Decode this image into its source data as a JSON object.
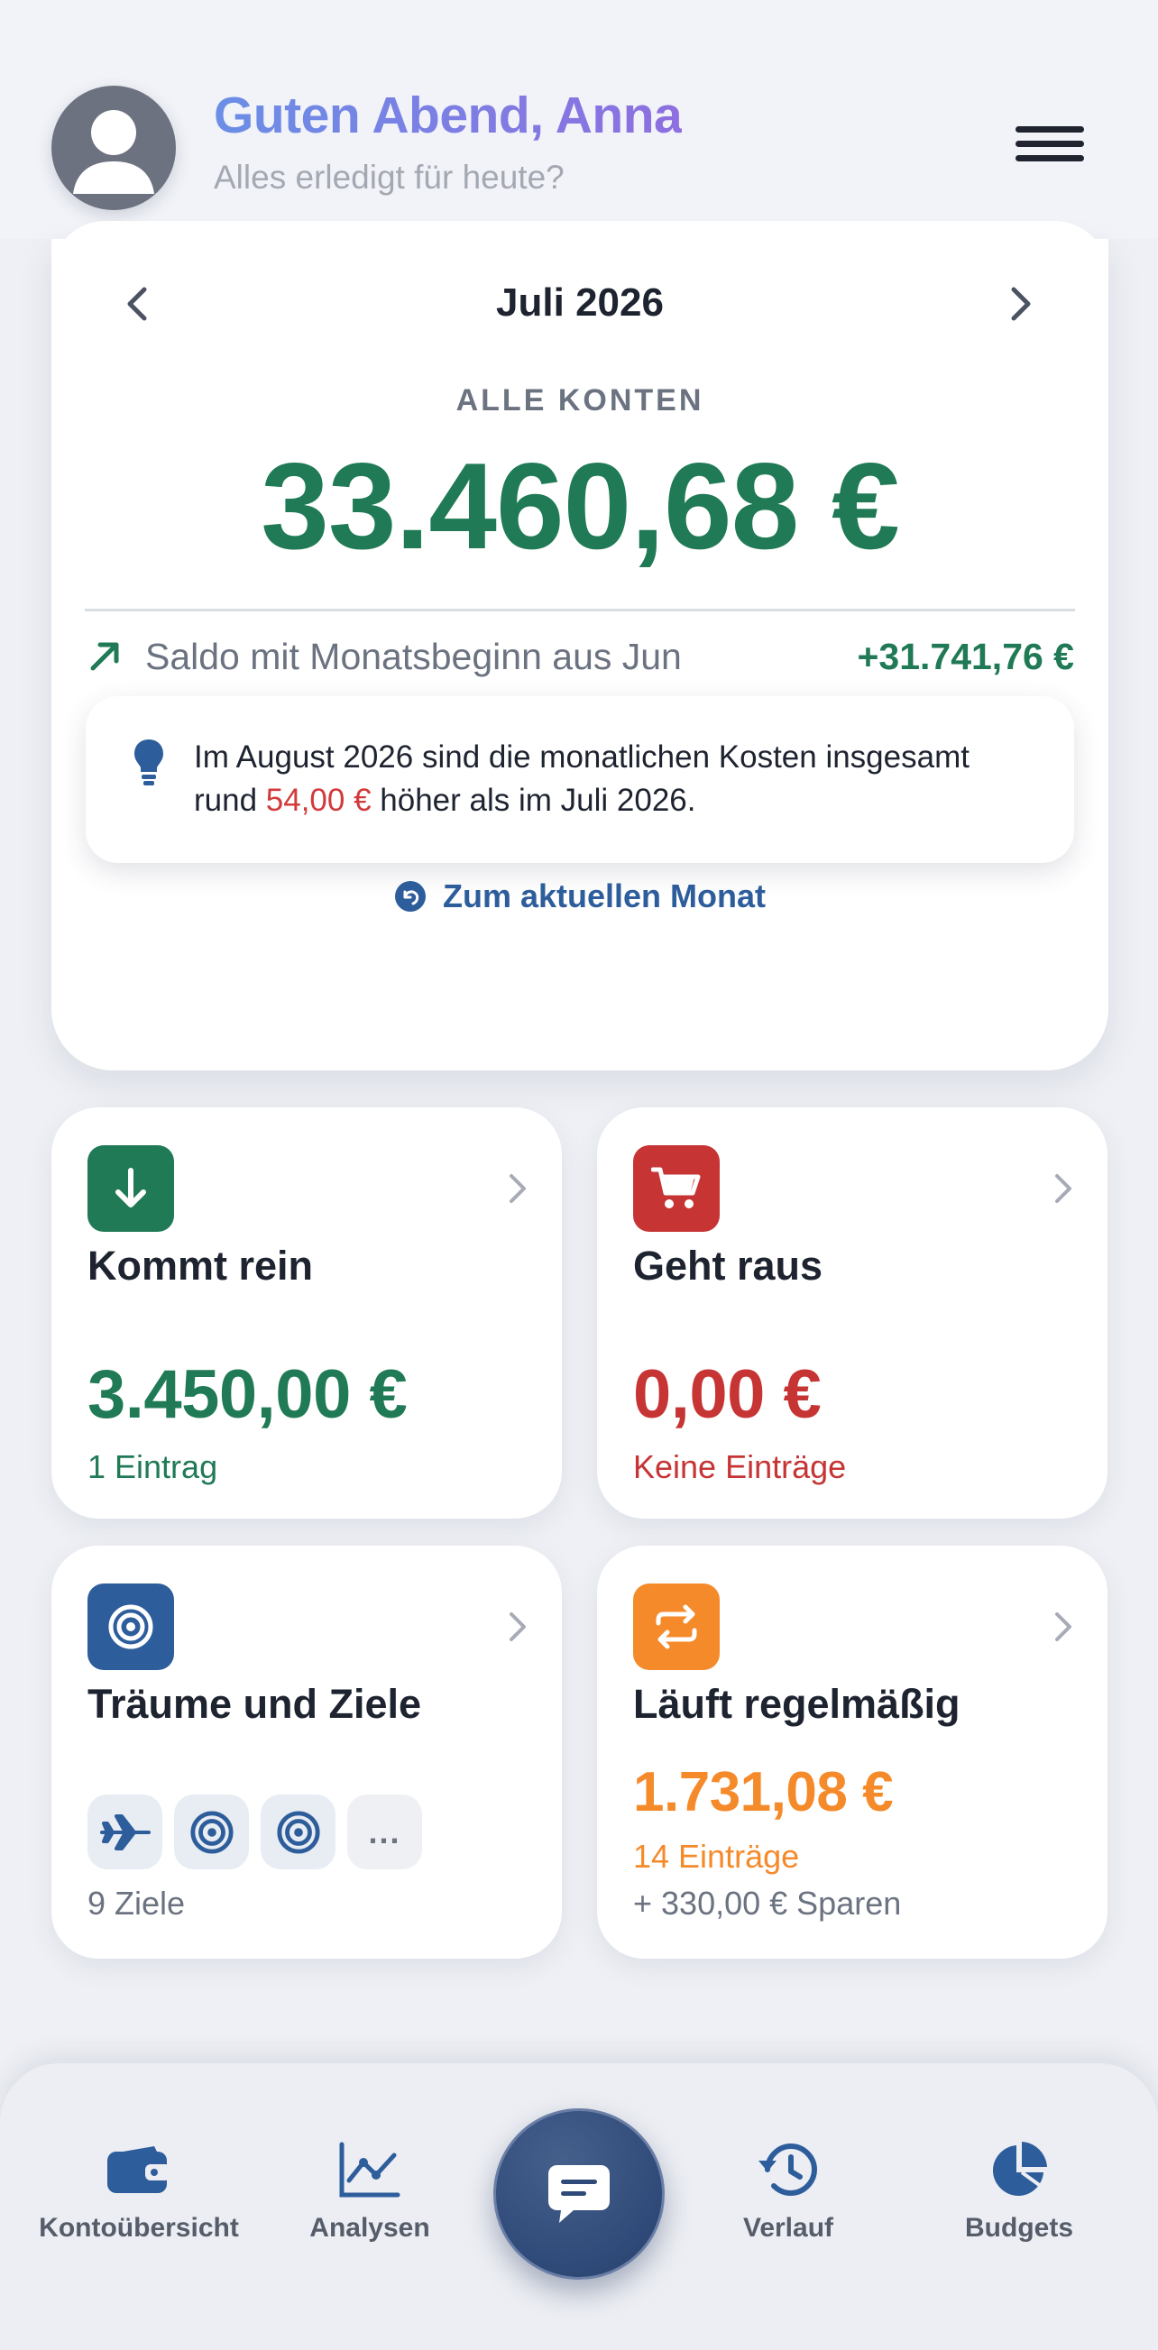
{
  "header": {
    "greeting": "Guten Abend, Anna",
    "subtitle": "Alles erledigt für heute?"
  },
  "overview": {
    "month": "Juli 2026",
    "accounts_label": "ALLE KONTEN",
    "balance": "33.460,68 €",
    "carryover_label": "Saldo mit Monatsbeginn aus Jun",
    "carryover_value": "+31.741,76 €",
    "hint_part1": "Im August 2026 sind die monatlichen Kosten insgesamt rund ",
    "hint_amount": "54,00 €",
    "hint_part2": " höher als im Juli 2026.",
    "current_month_link": "Zum aktuellen Monat"
  },
  "tiles": {
    "income": {
      "title": "Kommt rein",
      "amount": "3.450,00 €",
      "sub": "1 Eintrag"
    },
    "expenses": {
      "title": "Geht raus",
      "amount": "0,00 €",
      "sub": "Keine Einträge"
    },
    "goals": {
      "title": "Träume und Ziele",
      "more": "...",
      "sub": "9 Ziele"
    },
    "recurring": {
      "title": "Läuft regelmäßig",
      "amount": "1.731,08 €",
      "sub": "14 Einträge",
      "savings": "+ 330,00 € Sparen"
    }
  },
  "nav": {
    "accounts": "Kontoübersicht",
    "analytics": "Analysen",
    "history": "Verlauf",
    "budgets": "Budgets"
  },
  "colors": {
    "green": "#1f7a55",
    "red": "#c63434",
    "orange": "#f58a2b",
    "blue": "#2d5d9b",
    "greeting_gradient": [
      "#6b8ee6",
      "#8e6fe0"
    ]
  },
  "icons": [
    "user-avatar-icon",
    "menu-icon",
    "chevron-left-icon",
    "chevron-right-icon",
    "trend-up-icon",
    "lightbulb-icon",
    "undo-circle-icon",
    "arrow-down-icon",
    "cart-icon",
    "target-icon",
    "repeat-icon",
    "plane-icon",
    "wallet-icon",
    "chart-line-icon",
    "chat-icon",
    "history-icon",
    "pie-chart-icon"
  ]
}
